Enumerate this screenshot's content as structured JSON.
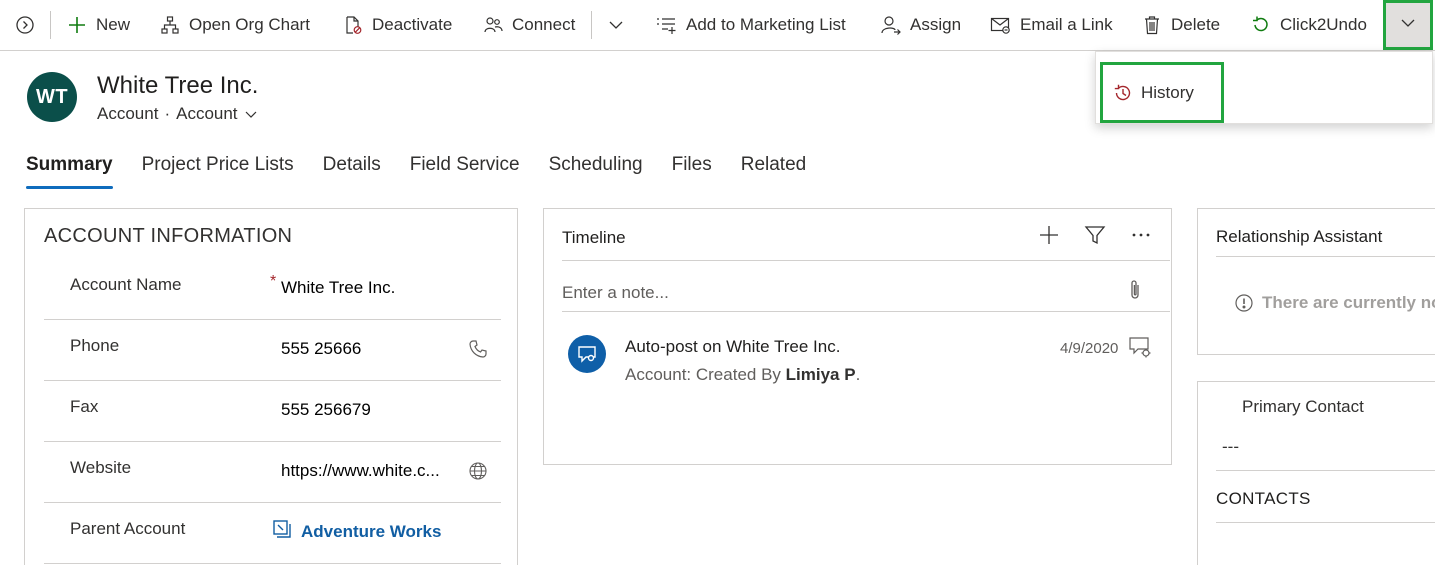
{
  "command_bar": {
    "items": [
      {
        "label": "New",
        "icon": "plus-icon"
      },
      {
        "label": "Open Org Chart",
        "icon": "org-chart-icon"
      },
      {
        "label": "Deactivate",
        "icon": "deactivate-icon"
      },
      {
        "label": "Connect",
        "icon": "connect-icon"
      },
      {
        "label": "Add to Marketing List",
        "icon": "add-list-icon"
      },
      {
        "label": "Assign",
        "icon": "assign-icon"
      },
      {
        "label": "Email a Link",
        "icon": "email-icon"
      },
      {
        "label": "Delete",
        "icon": "trash-icon"
      },
      {
        "label": "Click2Undo",
        "icon": "undo-icon"
      }
    ],
    "accent_color": "#22a53f"
  },
  "overflow_menu": {
    "items": [
      {
        "label": "History",
        "icon": "history-icon"
      }
    ]
  },
  "header": {
    "avatar_initials": "WT",
    "avatar_color": "#0b4f4a",
    "title": "White Tree Inc.",
    "entity": "Account",
    "form": "Account"
  },
  "tabs": [
    {
      "label": "Summary",
      "active": true
    },
    {
      "label": "Project Price Lists",
      "active": false
    },
    {
      "label": "Details",
      "active": false
    },
    {
      "label": "Field Service",
      "active": false
    },
    {
      "label": "Scheduling",
      "active": false
    },
    {
      "label": "Files",
      "active": false
    },
    {
      "label": "Related",
      "active": false
    }
  ],
  "account_info": {
    "title": "ACCOUNT INFORMATION",
    "fields": [
      {
        "label": "Account Name",
        "value": "White Tree Inc.",
        "required": "*"
      },
      {
        "label": "Phone",
        "value": "555 25666",
        "icon": "phone-icon"
      },
      {
        "label": "Fax",
        "value": "555 256679"
      },
      {
        "label": "Website",
        "value": "https://www.white.c...",
        "icon": "globe-icon"
      },
      {
        "label": "Parent Account",
        "value": "Adventure Works",
        "icon": "lookup-record-icon"
      }
    ]
  },
  "timeline": {
    "title": "Timeline",
    "note_placeholder": "Enter a note...",
    "post": {
      "title": "Auto-post on White Tree Inc.",
      "subtitle_prefix": "Account: Created By ",
      "author": "Limiya P",
      "suffix": ".",
      "date": "4/9/2020"
    }
  },
  "relationship_assistant": {
    "title": "Relationship Assistant",
    "empty_text": "There are currently no"
  },
  "primary_contact": {
    "label": "Primary Contact",
    "value": "---",
    "contacts_title": "CONTACTS"
  }
}
